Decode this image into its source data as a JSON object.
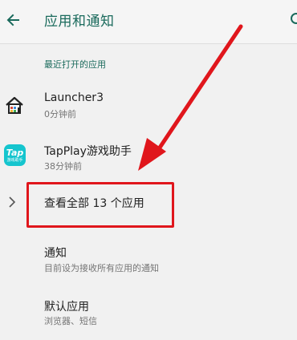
{
  "appbar": {
    "title": "应用和通知"
  },
  "recent": {
    "header": "最近打开的应用",
    "apps": [
      {
        "name": "Launcher3",
        "time": "0分钟前"
      },
      {
        "name": "TapPlay游戏助手",
        "time": "38分钟前",
        "icon_text": "Tap",
        "icon_sub": "游戏助手"
      }
    ],
    "see_all": "查看全部 13 个应用"
  },
  "settings": [
    {
      "name": "通知",
      "sub": "目前设为接收所有应用的通知"
    },
    {
      "name": "默认应用",
      "sub": "浏览器、短信"
    }
  ],
  "colors": {
    "accent": "#1a6a5c",
    "annotation_red": "#e0161c"
  }
}
